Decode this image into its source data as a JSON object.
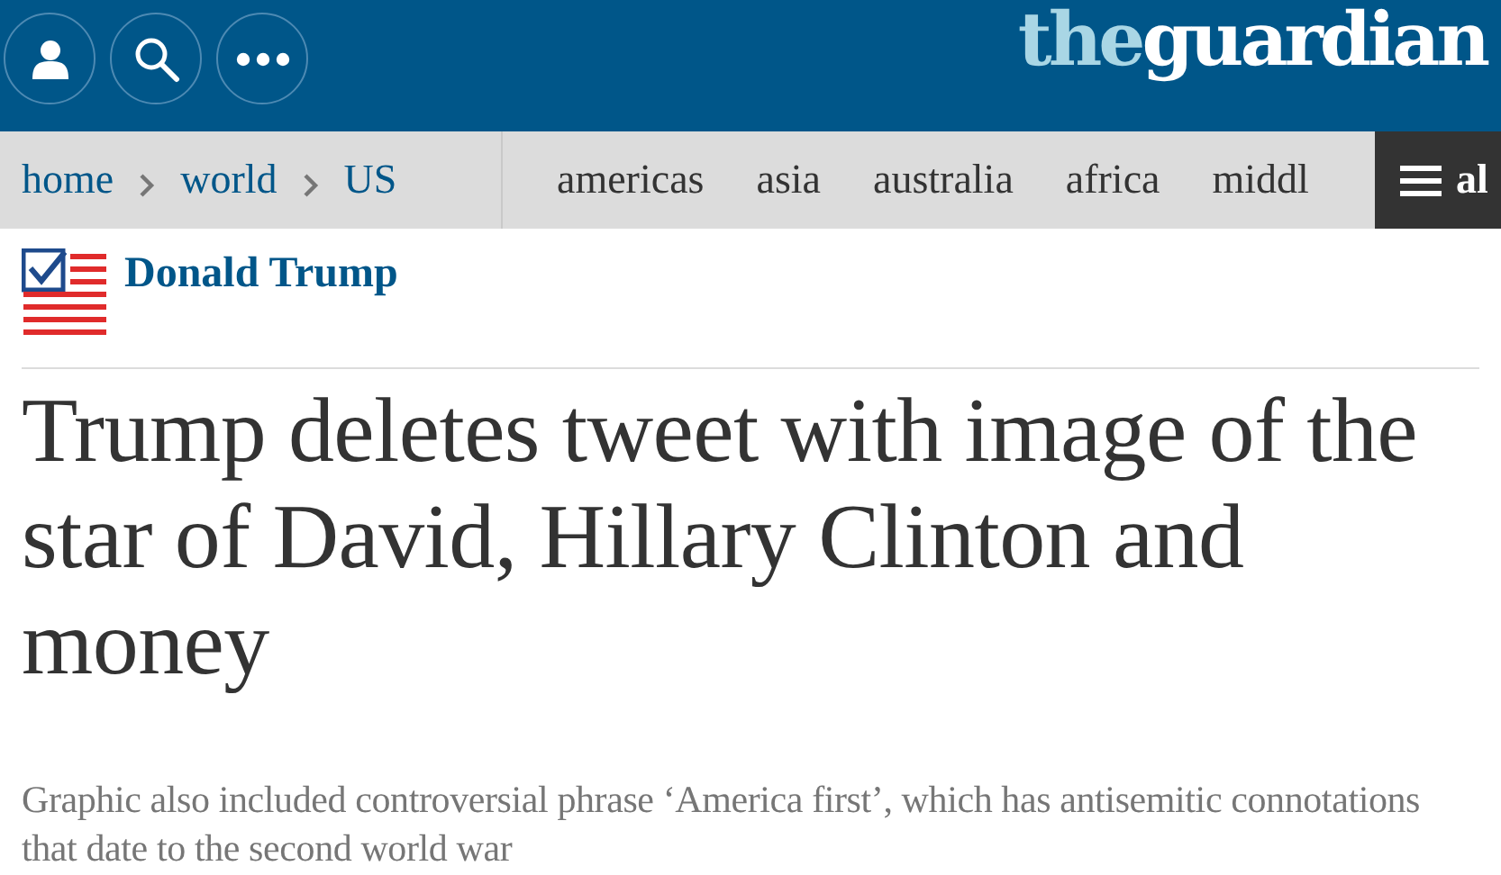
{
  "header": {
    "buttons": [
      {
        "kind": "profile"
      },
      {
        "kind": "search"
      },
      {
        "kind": "more"
      }
    ],
    "logo": {
      "prefix": "the",
      "name": "guardian"
    }
  },
  "breadcrumbs": [
    "home",
    "world",
    "US"
  ],
  "sections": [
    "americas",
    "asia",
    "australia",
    "africa",
    "middl"
  ],
  "all_button": {
    "label": "al"
  },
  "series": {
    "label": "Donald Trump"
  },
  "headline": "Trump deletes tweet with image of the star of David, Hillary Clinton and money",
  "standfirst": "Graphic also included controversial phrase ‘America first’, which has antisemitic connotations that date to the second world war"
}
